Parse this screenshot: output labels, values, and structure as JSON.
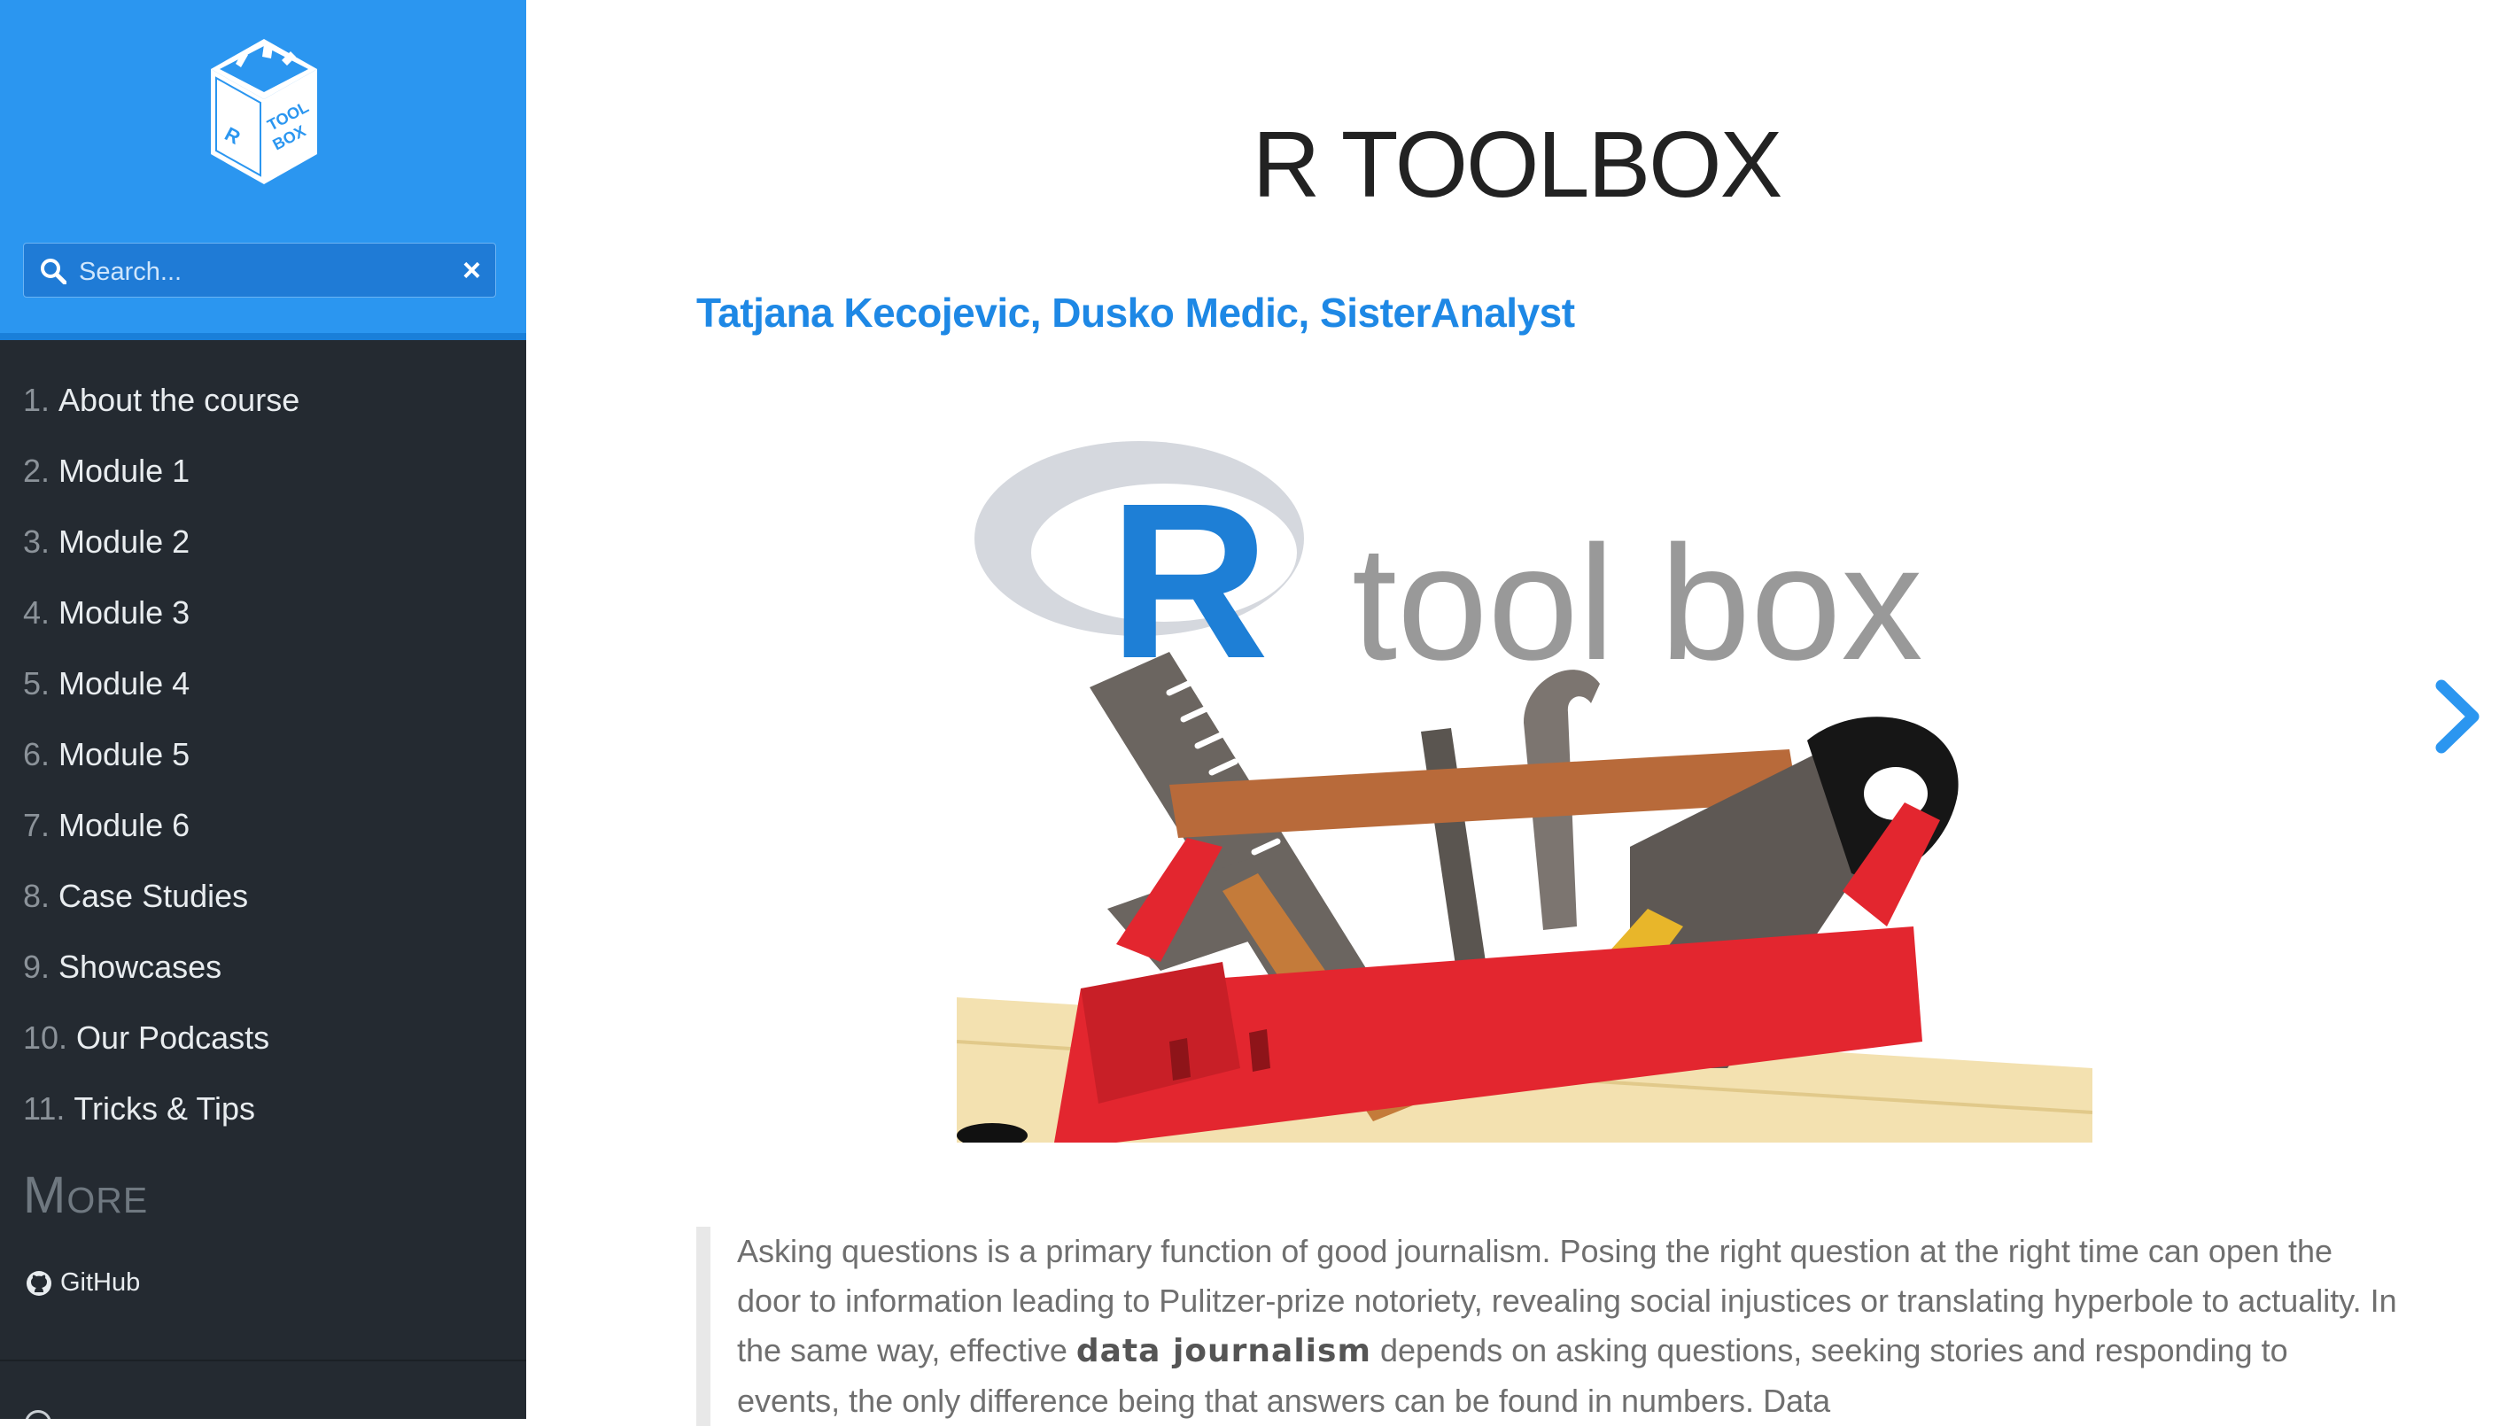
{
  "colors": {
    "accent": "#2b96f0",
    "sidebar_bg": "#242a31",
    "link": "#1e88e5"
  },
  "sidebar": {
    "logo_alt": "R TOOLBOX",
    "search": {
      "placeholder": "Search...",
      "clear_label": "×"
    },
    "items": [
      {
        "num": "1.",
        "label": "About the course"
      },
      {
        "num": "2.",
        "label": "Module 1"
      },
      {
        "num": "3.",
        "label": "Module 2"
      },
      {
        "num": "4.",
        "label": "Module 3"
      },
      {
        "num": "5.",
        "label": "Module 4"
      },
      {
        "num": "6.",
        "label": "Module 5"
      },
      {
        "num": "7.",
        "label": "Module 6"
      },
      {
        "num": "8.",
        "label": "Case Studies"
      },
      {
        "num": "9.",
        "label": "Showcases"
      },
      {
        "num": "10.",
        "label": "Our Podcasts"
      },
      {
        "num": "11.",
        "label": "Tricks & Tips"
      }
    ],
    "more_heading": "More",
    "github_label": "GitHub"
  },
  "main": {
    "title": "R TOOLBOX",
    "authors": "Tatjana Kecojevic, Dusko Medic, SisterAnalyst",
    "hero_text": "tool box",
    "hero_letter": "R",
    "quote": {
      "part1": "Asking questions is a primary function of good journalism. Posing the right question at the right time can open the door to information leading to Pulitzer-prize notoriety, revealing social injustices or translating hyperbole to actuality. In the same way, effective ",
      "bold": "data journalism",
      "part2": " depends on asking questions, seeking stories and responding to events, the only difference being that answers can be found in numbers. Data"
    }
  }
}
